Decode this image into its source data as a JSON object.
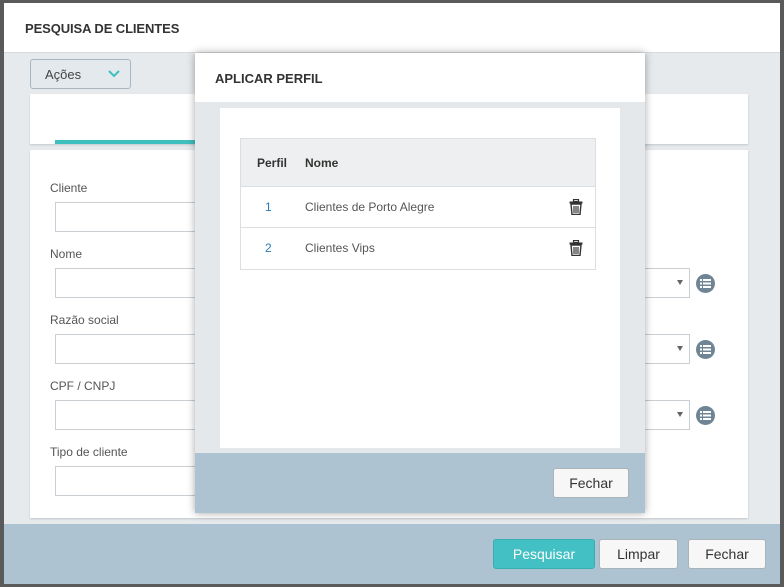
{
  "window": {
    "title": "PESQUISA DE CLIENTES"
  },
  "actions": {
    "label": "Ações",
    "icon": "chevron-down-icon"
  },
  "form": {
    "fields": [
      {
        "label": "Cliente",
        "value": ""
      },
      {
        "label": "Nome",
        "value": ""
      },
      {
        "label": "Razão social",
        "value": ""
      },
      {
        "label": "CPF / CNPJ",
        "value": ""
      },
      {
        "label": "Tipo de cliente",
        "value": ""
      }
    ]
  },
  "footer": {
    "search_label": "Pesquisar",
    "clear_label": "Limpar",
    "close_label": "Fechar"
  },
  "modal": {
    "title": "APLICAR PERFIL",
    "columns": {
      "profile": "Perfil",
      "name": "Nome"
    },
    "rows": [
      {
        "id": "1",
        "name": "Clientes de Porto Alegre"
      },
      {
        "id": "2",
        "name": "Clientes Vips"
      }
    ],
    "close_label": "Fechar"
  },
  "colors": {
    "accent": "#42c0c3",
    "footer": "#adc3d1",
    "link": "#2b7bb9"
  }
}
